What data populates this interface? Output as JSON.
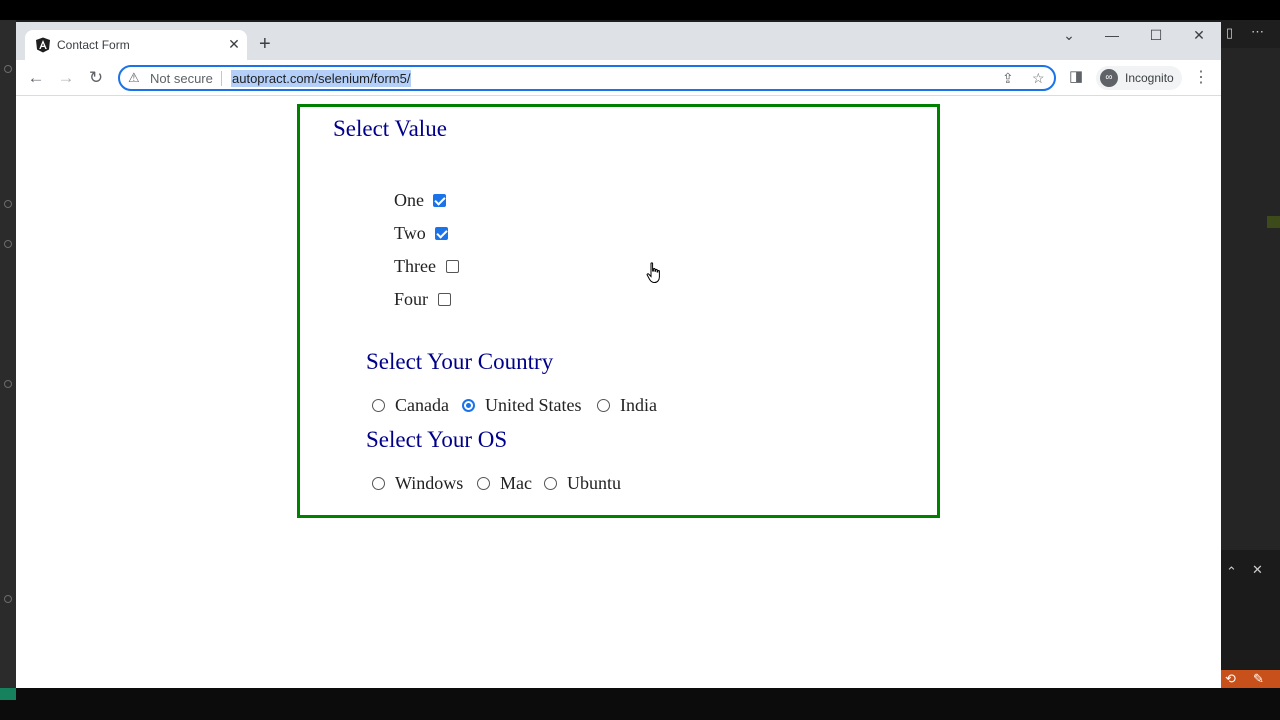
{
  "browser": {
    "tab": {
      "title": "Contact Form"
    },
    "address": {
      "security_label": "Not secure",
      "url": "autopract.com/selenium/form5/"
    },
    "profile": {
      "label": "Incognito"
    }
  },
  "form": {
    "values_section": {
      "heading": "Select Value",
      "checkboxes": [
        {
          "label": "One",
          "checked": true
        },
        {
          "label": "Two",
          "checked": true
        },
        {
          "label": "Three",
          "checked": false
        },
        {
          "label": "Four",
          "checked": false
        }
      ]
    },
    "country_section": {
      "heading": "Select Your Country",
      "options": [
        {
          "label": "Canada",
          "selected": false
        },
        {
          "label": "United States",
          "selected": true
        },
        {
          "label": "India",
          "selected": false
        }
      ]
    },
    "os_section": {
      "heading": "Select Your OS",
      "options": [
        {
          "label": "Windows",
          "selected": false
        },
        {
          "label": "Mac",
          "selected": false
        },
        {
          "label": "Ubuntu",
          "selected": false
        }
      ]
    }
  },
  "colors": {
    "form_border": "#008000",
    "heading": "#00008b",
    "accent": "#1a73e8"
  }
}
